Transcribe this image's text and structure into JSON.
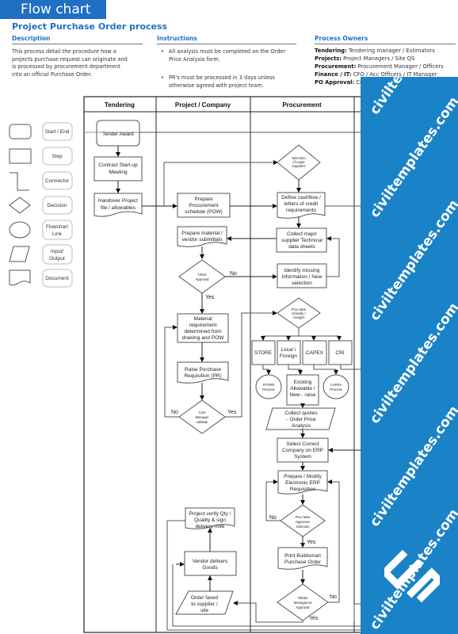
{
  "header": {
    "title": "Flow chart",
    "page_title": "Project Purchase Order process"
  },
  "description": {
    "heading": "Description",
    "lines": [
      "This process detail the procedure how a",
      "projects purchase request can originate and",
      "is processed by procurement department",
      "into an official Purchase Order."
    ]
  },
  "instructions": {
    "heading": "Instructions",
    "items": [
      {
        "line1": "All analysis must be completed on the Order",
        "line2": "Price Analysis form."
      },
      {
        "line1": "PR's must be processed in 3 days unless",
        "line2": "otherwise agreed with project team."
      }
    ]
  },
  "owners": {
    "heading": "Process Owners",
    "items": [
      {
        "role": "Tendering:",
        "value": "Tendering manager / Estimators"
      },
      {
        "role": "Projects:",
        "value": "Project Managers / Site QS"
      },
      {
        "role": "Procurement:",
        "value": "Procurement Manager / Officers"
      },
      {
        "role": "Finance / IT:",
        "value": "CFO / Acc Officers / IT Manager"
      },
      {
        "role": "PO Approval:",
        "value": "Co"
      }
    ]
  },
  "legend": [
    {
      "shape": "start-end",
      "label": "Start / End"
    },
    {
      "shape": "step",
      "label": "Step"
    },
    {
      "shape": "connector",
      "label": "Connector"
    },
    {
      "shape": "decision",
      "label": "Decision"
    },
    {
      "shape": "flowchart-link",
      "label1": "Flowchart",
      "label2": "Link"
    },
    {
      "shape": "input-output",
      "label1": "Input/",
      "label2": "Output"
    },
    {
      "shape": "document",
      "label": "Document"
    }
  ],
  "lanes": [
    "Tendering",
    "Project / Company",
    "Procurement"
  ],
  "nodes": {
    "tender_award": "Tender Award",
    "contract_startup": [
      "Contract Start-up",
      "Meeting"
    ],
    "handover": [
      "Handover Project",
      "file / allowables"
    ],
    "selection_suppliers": [
      "Selection",
      "of major",
      "suppliers"
    ],
    "prepare_procurement": [
      "Prepare",
      "Procurement",
      "schedule (POW)"
    ],
    "define_cashflow": [
      "Define cashflow /",
      "letters of credit",
      "requirements"
    ],
    "prepare_material": [
      "Prepare material /",
      "vendor submittals"
    ],
    "collect_major": [
      "Collect major",
      "supplier Technical",
      "data sheets"
    ],
    "client_approval": [
      "Client",
      "Approval"
    ],
    "identify_missing": [
      "Identify missing",
      "information / New",
      "selection"
    ],
    "material_requirement": [
      "Material",
      "requirement",
      "determined from",
      "drawing and POW"
    ],
    "proc_man_classify": [
      "Proc Man",
      "Classify /",
      "Assigns"
    ],
    "store": "STORE",
    "local_foreign": [
      "Local /",
      "Foreign"
    ],
    "capex": "CAPEX",
    "cri": "CRI",
    "raise_pr": [
      "Raise Purchase",
      "Requisition (PR)"
    ],
    "store_process": [
      "STORE",
      "Process"
    ],
    "existing_allowable": [
      "Existing",
      "Allowable /",
      "New - raise"
    ],
    "capex_process": [
      "CAPEX",
      "Process"
    ],
    "cost_manager": [
      "Cost",
      "Manager",
      "validate"
    ],
    "collect_quotes": [
      "Collect quotes",
      "- Order Price",
      "Analysis"
    ],
    "select_company": [
      "Select Correct",
      "Company on ERP",
      "System"
    ],
    "prepare_erp": [
      "Prepare / Modify",
      "Electronic ERP",
      "Requisition"
    ],
    "project_verify": [
      "Project verify Qty /",
      "Quality & sign",
      "delivery note"
    ],
    "proc_man_approves": [
      "Proc Man",
      "Approves",
      "selection"
    ],
    "vendor_delivers": [
      "Vendor delivers",
      "Goods"
    ],
    "print_po": [
      "Print Buildsmart",
      "Purchase Order"
    ],
    "order_faxed": [
      "Order faxed",
      "to supplier /",
      "site"
    ],
    "obtain_approval": [
      "Obtain",
      "Managment",
      "Approval"
    ]
  },
  "edge_labels": {
    "no": "No",
    "yes": "Yes"
  },
  "watermark": {
    "text": "civiltemplates.com",
    "color": "#1a83c7"
  },
  "colors": {
    "brand": "#1f6fc5"
  }
}
